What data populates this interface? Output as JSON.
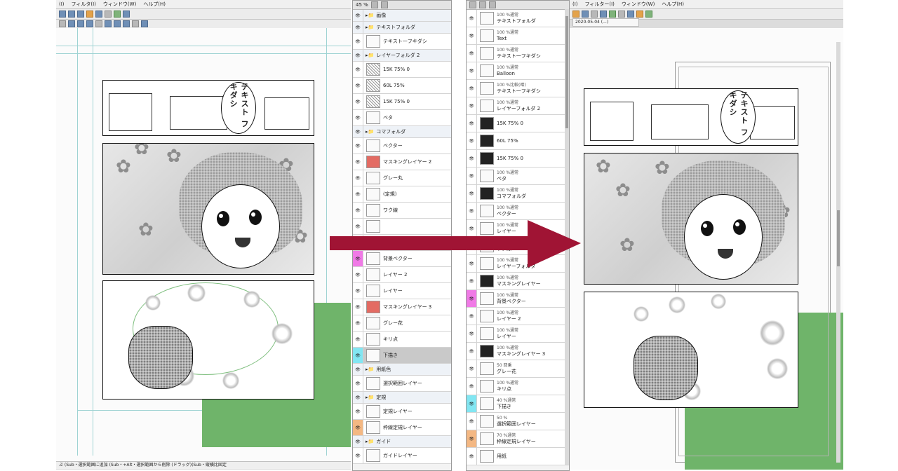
{
  "left_window": {
    "menu": [
      "(I)",
      "フィルタ(I)",
      "ウィンドウ(W)",
      "ヘルプ(H)"
    ],
    "status_text": "ぶ (Sub・選択範囲に追加 (Sub・+Alt・選択範囲から削除 (ドラッグ)(Sub・縦横比固定"
  },
  "right_window": {
    "menu": [
      "(I)",
      "フィルター(I)",
      "ウィンドウ(W)",
      "ヘルプ(H)"
    ],
    "tab_label": "2020-05-04 (...)"
  },
  "manga": {
    "bubble_text": "テキスト\nフキダシ"
  },
  "layers_left": {
    "zoom": "45 %",
    "rows": [
      {
        "type": "folder",
        "name": "画像"
      },
      {
        "type": "folder",
        "name": "テキストフォルダ"
      },
      {
        "type": "layer",
        "name": "テキスト一フキダシ",
        "thumb": ""
      },
      {
        "type": "folder",
        "name": "レイヤーフォルダ 2"
      },
      {
        "type": "layer",
        "name": "15K 75% 0",
        "thumb": "tex"
      },
      {
        "type": "layer",
        "name": "60L 75%",
        "thumb": "tex"
      },
      {
        "type": "layer",
        "name": "15K 75% 0",
        "thumb": "tex"
      },
      {
        "type": "layer",
        "name": "ベタ",
        "thumb": ""
      },
      {
        "type": "folder",
        "name": "コマフォルダ"
      },
      {
        "type": "layer",
        "name": "ベクター",
        "thumb": ""
      },
      {
        "type": "layer",
        "name": "マスキングレイヤー 2",
        "thumb": "red"
      },
      {
        "type": "layer",
        "name": "グレー丸",
        "thumb": ""
      },
      {
        "type": "layer",
        "name": "(定規)",
        "thumb": ""
      },
      {
        "type": "layer",
        "name": "ワク線",
        "thumb": ""
      },
      {
        "type": "layer",
        "name": "",
        "thumb": ""
      },
      {
        "type": "layer",
        "name": "マスキングレイヤー",
        "thumb": "red"
      },
      {
        "type": "layer",
        "name": "背景ベクター",
        "thumb": "",
        "eye": "m"
      },
      {
        "type": "layer",
        "name": "レイヤー 2",
        "thumb": ""
      },
      {
        "type": "layer",
        "name": "レイヤー",
        "thumb": ""
      },
      {
        "type": "layer",
        "name": "マスキングレイヤー 3",
        "thumb": "red"
      },
      {
        "type": "layer",
        "name": "グレー花",
        "thumb": ""
      },
      {
        "type": "layer",
        "name": "キリ点",
        "thumb": ""
      },
      {
        "type": "layer",
        "name": "下描き",
        "thumb": "",
        "eye": "c",
        "selected": true
      },
      {
        "type": "folder",
        "name": "用紙色"
      },
      {
        "type": "layer",
        "name": "選択範囲レイヤー",
        "thumb": ""
      },
      {
        "type": "folder",
        "name": "定規"
      },
      {
        "type": "layer",
        "name": "定規レイヤー",
        "thumb": ""
      },
      {
        "type": "layer",
        "name": "枠線定規レイヤー",
        "thumb": "",
        "eye": "p"
      },
      {
        "type": "folder",
        "name": "ガイド"
      },
      {
        "type": "layer",
        "name": "ガイドレイヤー",
        "thumb": ""
      }
    ]
  },
  "layers_right": {
    "rows": [
      {
        "mode": "100 %通常",
        "name": "テキストフォルダ",
        "thumb": ""
      },
      {
        "mode": "100 %通常",
        "name": "Text",
        "thumb": ""
      },
      {
        "mode": "100 %通常",
        "name": "テキスト一フキダシ",
        "thumb": ""
      },
      {
        "mode": "100 %通常",
        "name": "Balloon",
        "thumb": ""
      },
      {
        "mode": "100 %比較(暗)",
        "name": "テキスト一フキダシ",
        "thumb": ""
      },
      {
        "mode": "100 %通常",
        "name": "レイヤーフォルダ 2",
        "thumb": ""
      },
      {
        "mode": "",
        "name": "15K 75% 0",
        "thumb": "dark"
      },
      {
        "mode": "",
        "name": "60L 75%",
        "thumb": "dark"
      },
      {
        "mode": "",
        "name": "15K 75% 0",
        "thumb": "dark"
      },
      {
        "mode": "100 %通常",
        "name": "ベタ",
        "thumb": ""
      },
      {
        "mode": "100 %通常",
        "name": "コマフォルダ",
        "thumb": "dark"
      },
      {
        "mode": "100 %通常",
        "name": "ベクター",
        "thumb": ""
      },
      {
        "mode": "100 %通常",
        "name": "レイヤー",
        "thumb": ""
      },
      {
        "mode": "100 %通常",
        "name": "ワク線",
        "thumb": ""
      },
      {
        "mode": "100 %通常",
        "name": "レイヤーフォルダ",
        "thumb": ""
      },
      {
        "mode": "100 %通常",
        "name": "マスキングレイヤー",
        "thumb": "dark"
      },
      {
        "mode": "100 %通常",
        "name": "背景ベクター",
        "thumb": "",
        "eye": "m"
      },
      {
        "mode": "100 %通常",
        "name": "レイヤー 2",
        "thumb": ""
      },
      {
        "mode": "100 %通常",
        "name": "レイヤー",
        "thumb": ""
      },
      {
        "mode": "100 %通常",
        "name": "マスキングレイヤー 3",
        "thumb": "dark"
      },
      {
        "mode": "50 回乗",
        "name": "グレー花",
        "thumb": ""
      },
      {
        "mode": "100 %通常",
        "name": "キリ点",
        "thumb": ""
      },
      {
        "mode": "40 %通常",
        "name": "下描き",
        "thumb": "",
        "eye": "c"
      },
      {
        "mode": "50 %",
        "name": "選択範囲レイヤー",
        "thumb": ""
      },
      {
        "mode": "70 %通常",
        "name": "枠線定規レイヤー",
        "thumb": "",
        "eye": "p"
      },
      {
        "mode": "",
        "name": "用紙",
        "thumb": ""
      }
    ]
  },
  "colors": {
    "arrow": "#a01434",
    "green_block": "#6fb46a",
    "guide": "#9fd3d3",
    "selected_eye": "#82e6f2",
    "magenta_eye": "#f07ae6",
    "orange_eye": "#f4b883"
  }
}
